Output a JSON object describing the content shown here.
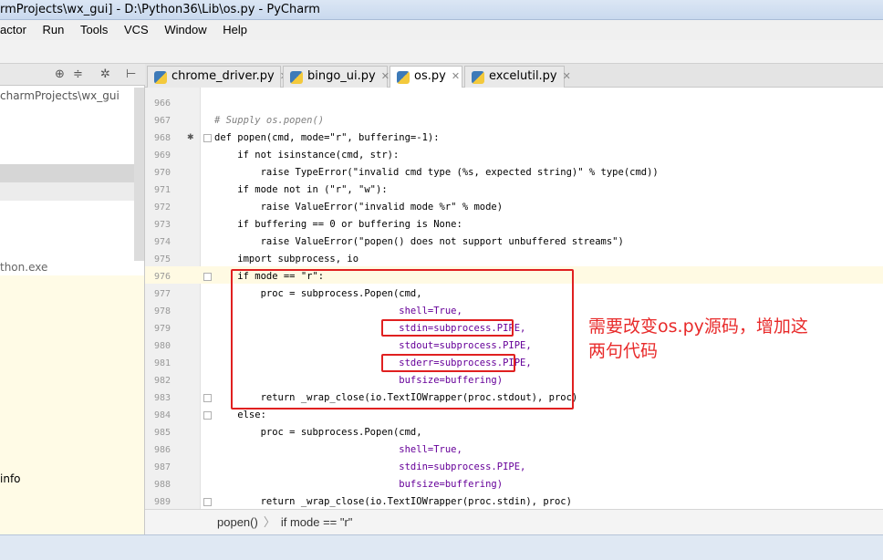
{
  "window": {
    "title": "rmProjects\\wx_gui] - D:\\Python36\\Lib\\os.py - PyCharm"
  },
  "menu": {
    "items": [
      {
        "label": "actor"
      },
      {
        "label": "Run"
      },
      {
        "label": "Tools"
      },
      {
        "label": "VCS"
      },
      {
        "label": "Window"
      },
      {
        "label": "Help"
      }
    ]
  },
  "project_panel": {
    "path": "charmProjects\\wx_gui",
    "interpreter": "thon.exe",
    "info": "info",
    "icons": [
      "globe-icon",
      "collapse-icon",
      "gear-icon",
      "pin-icon"
    ]
  },
  "tabs": [
    {
      "label": "chrome_driver.py",
      "active": false
    },
    {
      "label": "bingo_ui.py",
      "active": false
    },
    {
      "label": "os.py",
      "active": true
    },
    {
      "label": "excelutil.py",
      "active": false
    }
  ],
  "editor": {
    "current_line": 976,
    "lines": [
      {
        "n": "966",
        "text": ""
      },
      {
        "n": "967",
        "text": "# Supply os.popen()"
      },
      {
        "n": "968",
        "text": "def popen(cmd, mode=\"r\", buffering=-1):"
      },
      {
        "n": "969",
        "text": "    if not isinstance(cmd, str):"
      },
      {
        "n": "970",
        "text": "        raise TypeError(\"invalid cmd type (%s, expected string)\" % type(cmd))"
      },
      {
        "n": "971",
        "text": "    if mode not in (\"r\", \"w\"):"
      },
      {
        "n": "972",
        "text": "        raise ValueError(\"invalid mode %r\" % mode)"
      },
      {
        "n": "973",
        "text": "    if buffering == 0 or buffering is None:"
      },
      {
        "n": "974",
        "text": "        raise ValueError(\"popen() does not support unbuffered streams\")"
      },
      {
        "n": "975",
        "text": "    import subprocess, io"
      },
      {
        "n": "976",
        "text": "    if mode == \"r\":"
      },
      {
        "n": "977",
        "text": "        proc = subprocess.Popen(cmd,"
      },
      {
        "n": "978",
        "text": "                                shell=True,"
      },
      {
        "n": "979",
        "text": "                                stdin=subprocess.PIPE,"
      },
      {
        "n": "980",
        "text": "                                stdout=subprocess.PIPE,"
      },
      {
        "n": "981",
        "text": "                                stderr=subprocess.PIPE,"
      },
      {
        "n": "982",
        "text": "                                bufsize=buffering)"
      },
      {
        "n": "983",
        "text": "        return _wrap_close(io.TextIOWrapper(proc.stdout), proc)"
      },
      {
        "n": "984",
        "text": "    else:"
      },
      {
        "n": "985",
        "text": "        proc = subprocess.Popen(cmd,"
      },
      {
        "n": "986",
        "text": "                                shell=True,"
      },
      {
        "n": "987",
        "text": "                                stdin=subprocess.PIPE,"
      },
      {
        "n": "988",
        "text": "                                bufsize=buffering)"
      },
      {
        "n": "989",
        "text": "        return _wrap_close(io.TextIOWrapper(proc.stdin), proc)"
      }
    ]
  },
  "annotation": {
    "note_line1": "需要改变os.py源码，增加这",
    "note_line2": "两句代码",
    "color": "#e02020"
  },
  "breadcrumb": {
    "items": [
      "popen()",
      "if mode == \"r\""
    ]
  }
}
